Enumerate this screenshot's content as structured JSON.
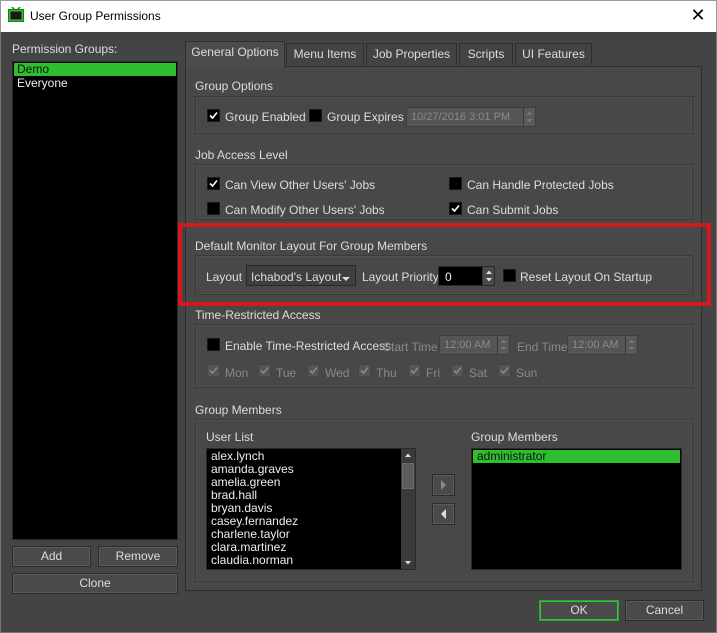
{
  "window": {
    "title": "User Group Permissions",
    "close_symbol": "✕"
  },
  "sidebar": {
    "label": "Permission Groups:",
    "groups": [
      {
        "name": "Demo",
        "selected": true
      },
      {
        "name": "Everyone",
        "selected": false
      }
    ],
    "add_label": "Add",
    "remove_label": "Remove",
    "clone_label": "Clone"
  },
  "tabs": [
    {
      "label": "General Options",
      "active": true
    },
    {
      "label": "Menu Items",
      "active": false
    },
    {
      "label": "Job Properties",
      "active": false
    },
    {
      "label": "Scripts",
      "active": false
    },
    {
      "label": "UI Features",
      "active": false
    }
  ],
  "group_options": {
    "title": "Group Options",
    "enabled_label": "Group Enabled",
    "enabled_checked": true,
    "expires_label": "Group Expires",
    "expires_checked": false,
    "expires_value": "10/27/2016 3:01 PM"
  },
  "job_access": {
    "title": "Job Access Level",
    "view_label": "Can View Other Users' Jobs",
    "view_checked": true,
    "modify_label": "Can Modify Other Users' Jobs",
    "modify_checked": false,
    "protected_label": "Can Handle Protected Jobs",
    "protected_checked": false,
    "submit_label": "Can Submit Jobs",
    "submit_checked": true
  },
  "monitor_layout": {
    "title": "Default Monitor Layout For Group Members",
    "layout_label": "Layout",
    "layout_value": "Ichabod's Layout",
    "priority_label": "Layout Priority",
    "priority_value": "0",
    "reset_label": "Reset Layout On Startup",
    "reset_checked": false
  },
  "time_access": {
    "title": "Time-Restricted Access",
    "enable_label": "Enable Time-Restricted Access",
    "enable_checked": false,
    "start_label": "Start Time",
    "start_value": "12:00 AM",
    "end_label": "End Time",
    "end_value": "12:00 AM",
    "days": [
      "Mon",
      "Tue",
      "Wed",
      "Thu",
      "Fri",
      "Sat",
      "Sun"
    ]
  },
  "group_members": {
    "title": "Group Members",
    "user_list_label": "User List",
    "users": [
      "alex.lynch",
      "amanda.graves",
      "amelia.green",
      "brad.hall",
      "bryan.davis",
      "casey.fernandez",
      "charlene.taylor",
      "clara.martinez",
      "claudia.norman"
    ],
    "members_label": "Group Members",
    "members": [
      "administrator"
    ]
  },
  "footer": {
    "ok_label": "OK",
    "cancel_label": "Cancel"
  },
  "colors": {
    "accent": "#2dbf2d",
    "highlight": "#d3181e",
    "background": "#444444"
  }
}
